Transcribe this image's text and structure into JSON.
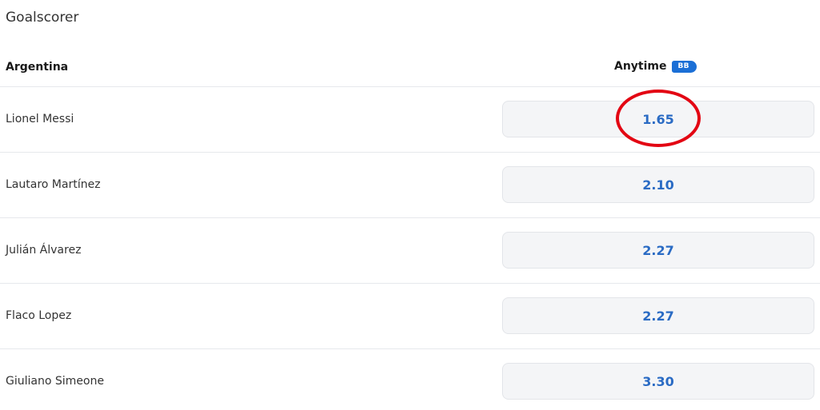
{
  "market": {
    "title": "Goalscorer"
  },
  "table": {
    "team": "Argentina",
    "column_label": "Anytime",
    "badge_label": "BB",
    "rows": [
      {
        "player": "Lionel Messi",
        "odds": "1.65"
      },
      {
        "player": "Lautaro Martínez",
        "odds": "2.10"
      },
      {
        "player": "Julián Álvarez",
        "odds": "2.27"
      },
      {
        "player": "Flaco Lopez",
        "odds": "2.27"
      },
      {
        "player": "Giuliano Simeone",
        "odds": "3.30"
      }
    ]
  },
  "colors": {
    "odds_text": "#2a6bc4",
    "badge_bg": "#1b6fd6",
    "highlight": "#e30613"
  },
  "annotation": {
    "highlighted_row": 0
  }
}
